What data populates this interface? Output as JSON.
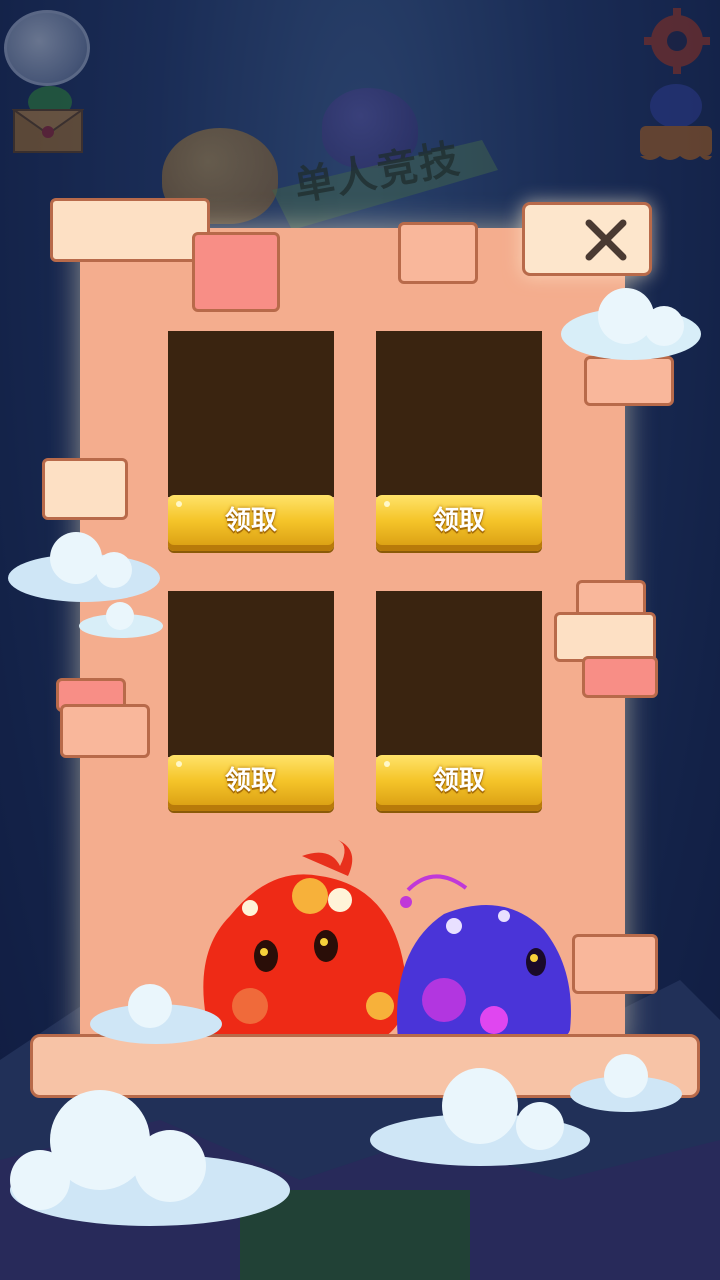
{
  "title": "单人竞技",
  "rewards": [
    {
      "button_label": "领取"
    },
    {
      "button_label": "领取"
    },
    {
      "button_label": "领取"
    },
    {
      "button_label": "领取"
    }
  ],
  "icons": {
    "close": "close-icon",
    "gear": "gear-icon",
    "mail": "mail-icon",
    "shop": "shop-icon"
  },
  "colors": {
    "panel": "#f4ad8e",
    "slot": "#3a2410",
    "button": "#f5c52a",
    "red_slime": "#ee2a16",
    "blue_slime": "#4a34d8"
  }
}
